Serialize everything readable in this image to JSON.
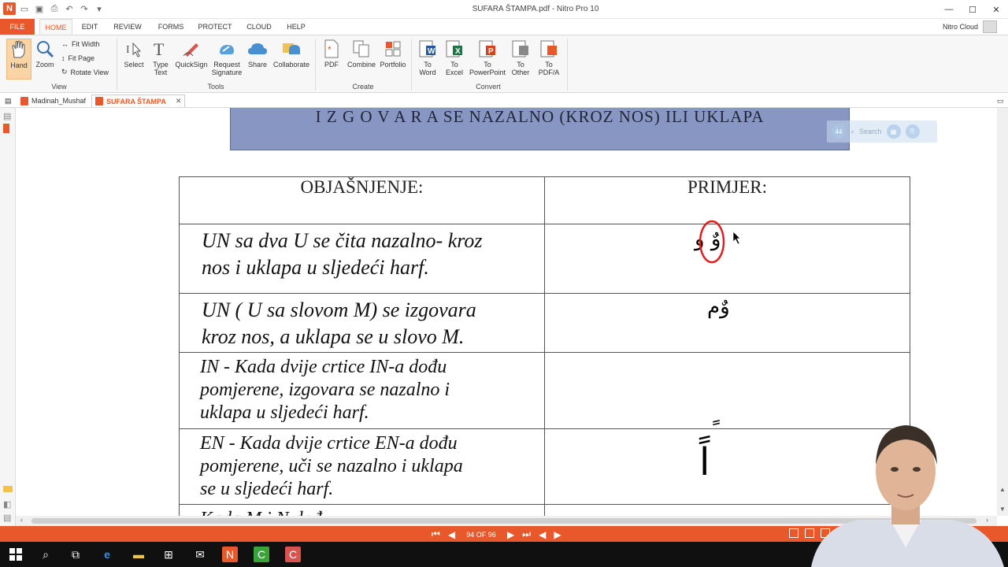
{
  "window": {
    "title": "SUFARA ŠTAMPA.pdf - Nitro Pro 10"
  },
  "ribbon_tabs": [
    "FILE",
    "HOME",
    "EDIT",
    "REVIEW",
    "FORMS",
    "PROTECT",
    "CLOUD",
    "HELP"
  ],
  "active_tab": "HOME",
  "cloud": {
    "label": "Nitro Cloud"
  },
  "ribbon": {
    "view": {
      "hand": "Hand",
      "zoom": "Zoom",
      "fit_width": "Fit Width",
      "fit_page": "Fit Page",
      "rotate_view": "Rotate View",
      "group": "View"
    },
    "tools": {
      "select": "Select",
      "type_text_1": "Type",
      "type_text_2": "Text",
      "quicksign": "QuickSign",
      "request_1": "Request",
      "request_2": "Signature",
      "share": "Share",
      "collaborate": "Collaborate",
      "group": "Tools"
    },
    "create": {
      "pdf": "PDF",
      "combine": "Combine",
      "portfolio": "Portfolio",
      "group": "Create"
    },
    "convert": {
      "to": "To",
      "word": "Word",
      "excel": "Excel",
      "powerpoint": "PowerPoint",
      "other": "Other",
      "pdfa": "PDF/A",
      "group": "Convert"
    }
  },
  "doc_tabs": [
    {
      "label": "Madinah_Mushaf",
      "active": false
    },
    {
      "label": "SUFARA ŠTAMPA",
      "active": true
    }
  ],
  "document": {
    "banner": "I Z G O V A R A  SE NAZALNO (KROZ NOS) ILI UKLAPA",
    "floating_toolbar": {
      "page": "44",
      "search": "Search"
    },
    "table": {
      "headers": [
        "OBJAŠNJENJE:",
        "PRIMJER:"
      ],
      "rows": [
        {
          "lines": [
            "UN sa dva U se čita nazalno- kroz",
            "nos i uklapa u sljedeći harf."
          ],
          "example": "وٌ و"
        },
        {
          "lines": [
            "UN ( U sa slovom M) se izgovara",
            "kroz nos, a uklapa se u slovo M."
          ],
          "example": "وٌم"
        },
        {
          "lines": [
            "IN - Kada dvije crtice IN-a dođu",
            "pomjerene, izgovara se nazalno i",
            "uklapa u sljedeći harf."
          ],
          "example": "ٍ"
        },
        {
          "lines": [
            "EN - Kada dvije crtice EN-a dođu",
            "pomjerene, uči se nazalno i uklapa",
            "se u sljedeći harf."
          ],
          "example": "اً"
        }
      ],
      "cut_row": "Kada M i N dođu ..."
    }
  },
  "status": {
    "page_indicator": "94 OF 96"
  },
  "colors": {
    "accent": "#e8582a",
    "banner": "#8796c2",
    "taskbar": "#101010"
  }
}
